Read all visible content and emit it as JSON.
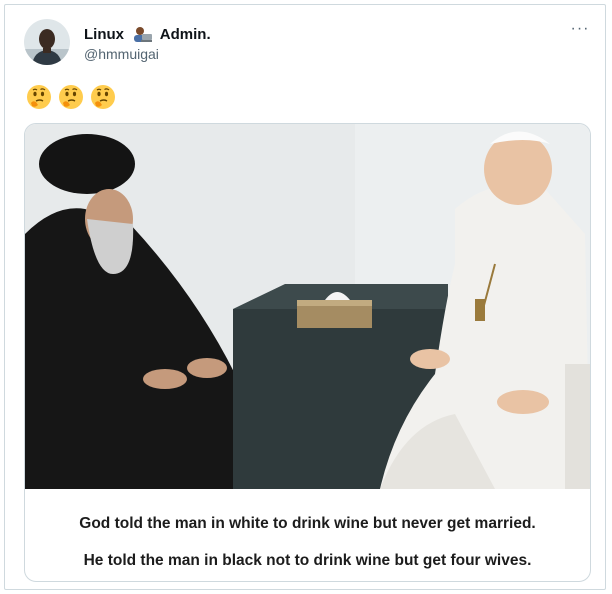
{
  "tweet": {
    "display_name_part1": "Linux",
    "display_name_part2": "Admin.",
    "name_emoji": "technologist-emoji",
    "handle": "@hmmuigai",
    "more_label": "···",
    "body_emojis": [
      "thinking-face-emoji",
      "thinking-face-emoji",
      "thinking-face-emoji"
    ]
  },
  "media": {
    "caption_line1": "God told the man in white to drink wine but never get married.",
    "caption_line2": "He told the man in black not to drink wine but get four wives."
  },
  "colors": {
    "border": "#cfd9de",
    "secondary_text": "#536471",
    "primary_text": "#0f1419"
  }
}
